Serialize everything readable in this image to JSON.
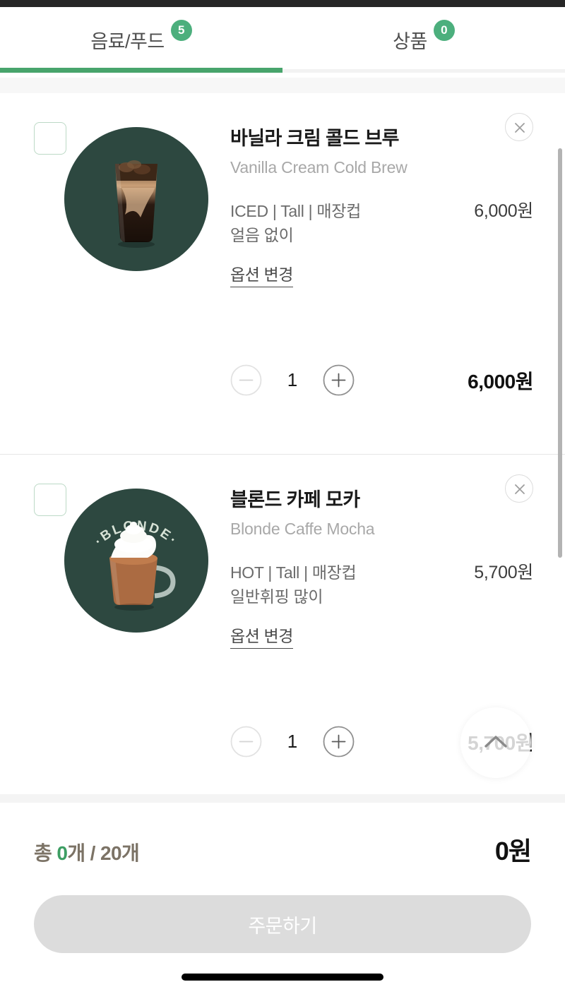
{
  "app": {
    "screen_name": "장바구니",
    "accent_green": "#48a46c",
    "badge_green": "#4caf7d",
    "thumb_bg": "#2d4840",
    "summary_brown": "#7c7366"
  },
  "tabs": [
    {
      "label": "음료/푸드",
      "badge": "5",
      "active": true
    },
    {
      "label": "상품",
      "badge": "0",
      "active": false
    }
  ],
  "items": [
    {
      "name_ko": "바닐라 크림 콜드 브루",
      "name_en": "Vanilla Cream Cold Brew",
      "options_line1": "ICED | Tall | 매장컵",
      "options_line2": "얼음 없이",
      "unit_price": "6,000원",
      "option_change_label": "옵션 변경",
      "quantity": "1",
      "line_total": "6,000원",
      "thumb_label": "",
      "checkbox_checked": false,
      "minus_enabled": false,
      "plus_enabled": true
    },
    {
      "name_ko": "블론드 카페 모카",
      "name_en": "Blonde Caffe Mocha",
      "options_line1": "HOT | Tall | 매장컵",
      "options_line2": "일반휘핑 많이",
      "unit_price": "5,700원",
      "option_change_label": "옵션 변경",
      "quantity": "1",
      "line_total": "5,700원",
      "thumb_label": "·BLONDE·",
      "checkbox_checked": false,
      "minus_enabled": false,
      "plus_enabled": true
    }
  ],
  "summary": {
    "count_label_prefix": "총 ",
    "count_current": "0",
    "count_middle": "개 / ",
    "count_max": "20개",
    "total_price": "0원"
  },
  "order_button": {
    "label": "주문하기",
    "enabled": false
  },
  "icons": {
    "close": "close-icon",
    "minus": "minus-icon",
    "plus": "plus-icon",
    "scroll_top": "chevron-up-icon"
  }
}
